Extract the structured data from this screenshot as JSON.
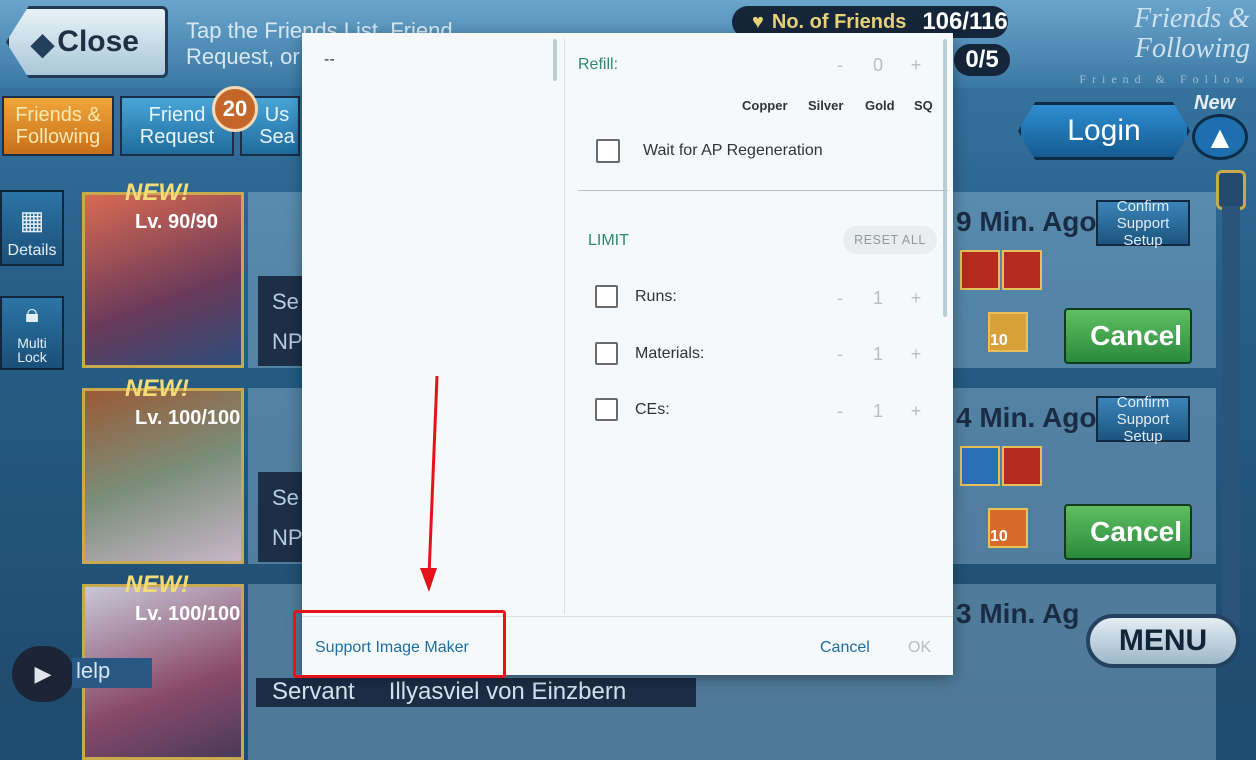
{
  "background": {
    "close_label": "Close",
    "hint_text": "Tap the Friends List, Friend Request, or Friend Search butt",
    "friends_label": "No. of Friends",
    "friends_count": "106/116",
    "friend_ratio": "0/5",
    "title_line1": "Friends &",
    "title_line2": "Following",
    "title_sub": "Friend & Follow",
    "tabs": [
      {
        "label": "Friends & Following"
      },
      {
        "label": "Friend Request"
      },
      {
        "label": "Us Sea"
      }
    ],
    "request_badge": "20",
    "side_buttons": [
      {
        "label": "Details",
        "icon": "cards-icon"
      },
      {
        "label": "Multi Lock",
        "icon": "lock-icon"
      }
    ],
    "cards": [
      {
        "new": "NEW!",
        "level": "Lv. 90/90",
        "ago": "9 Min. Ago"
      },
      {
        "new": "NEW!",
        "level": "Lv. 100/100",
        "ago": "4 Min. Ago"
      },
      {
        "new": "NEW!",
        "level": "Lv. 100/100",
        "ago": "3 Min. Ag"
      }
    ],
    "row_label_1": "Se",
    "row_label_2": "NP",
    "confirm_label": "Confirm Support Setup",
    "cancel_label": "Cancel",
    "skill_level": "10",
    "login_label": "Login",
    "new_badge": "New",
    "menu_label": "MENU",
    "help_label": "lelp",
    "servant_label": "Servant",
    "servant_name": "Illyasviel von Einzbern"
  },
  "dialog": {
    "left_item": "--",
    "refill": {
      "label": "Refill:",
      "minus": "-",
      "value": "0",
      "plus": "+",
      "currencies": [
        "Copper",
        "Silver",
        "Gold",
        "SQ"
      ]
    },
    "wait_ap_label": "Wait for AP Regeneration",
    "limit": {
      "label": "LIMIT",
      "reset_label": "RESET ALL",
      "items": [
        {
          "label": "Runs:",
          "minus": "-",
          "value": "1",
          "plus": "+"
        },
        {
          "label": "Materials:",
          "minus": "-",
          "value": "1",
          "plus": "+"
        },
        {
          "label": "CEs:",
          "minus": "-",
          "value": "1",
          "plus": "+"
        }
      ]
    },
    "footer": {
      "support_image_maker": "Support Image Maker",
      "cancel": "Cancel",
      "ok": "OK"
    }
  },
  "colors": {
    "accent_green": "#2e8b6f",
    "link_blue": "#1d6fa3",
    "annotation_red": "#e4131b"
  }
}
